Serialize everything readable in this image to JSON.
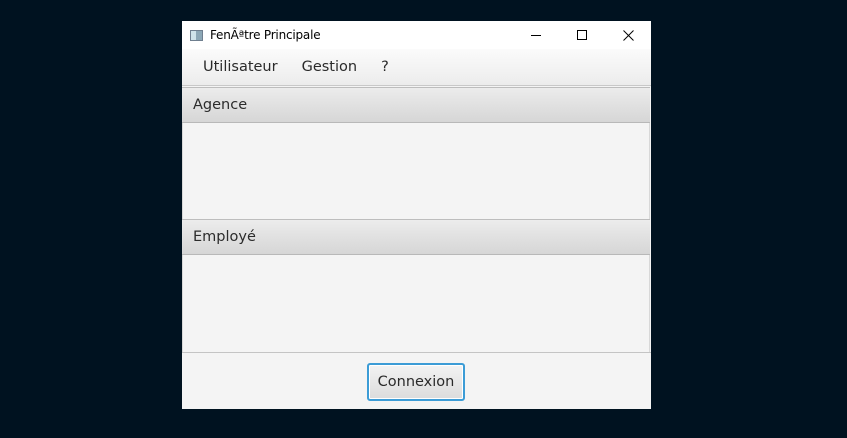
{
  "window": {
    "title": "FenÃªtre Principale",
    "controls": {
      "minimize_icon": "minimize-icon",
      "maximize_icon": "maximize-icon",
      "close_icon": "close-icon"
    }
  },
  "menubar": {
    "items": [
      {
        "label": "Utilisateur"
      },
      {
        "label": "Gestion"
      },
      {
        "label": "?"
      }
    ]
  },
  "panes": [
    {
      "title": "Agence"
    },
    {
      "title": "Employé"
    }
  ],
  "footer": {
    "connect_label": "Connexion"
  },
  "colors": {
    "desktop_background": "#001220",
    "window_background": "#f4f4f4",
    "focus_border": "#3c9cd6"
  }
}
